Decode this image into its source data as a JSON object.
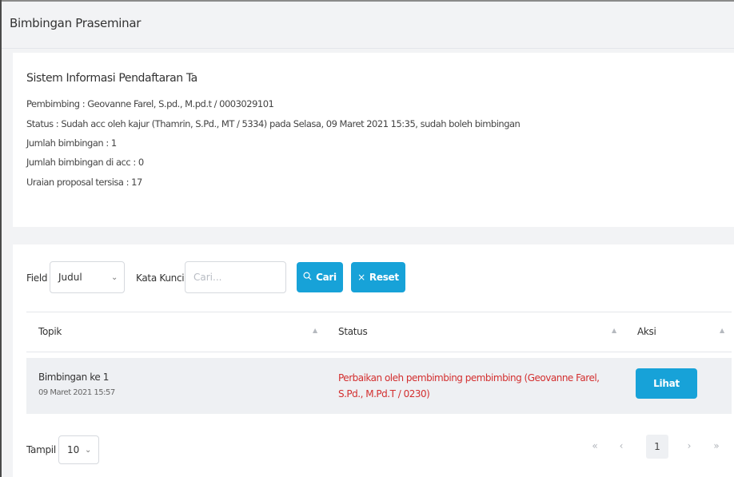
{
  "header": {
    "title": "Bimbingan Praseminar"
  },
  "info": {
    "title": "Sistem Informasi Pendaftaran Ta",
    "pembimbing": "Pembimbing : Geovanne Farel, S.pd., M.pd.t / 0003029101",
    "status": "Status : Sudah acc oleh kajur (Thamrin, S.Pd., MT / 5334) pada Selasa, 09 Maret 2021 15:35, sudah boleh bimbingan",
    "jumlah_bimbingan": "Jumlah bimbingan : 1",
    "jumlah_acc": "Jumlah bimbingan di acc : 0",
    "uraian": "Uraian proposal tersisa : 17"
  },
  "filter": {
    "field_label": "Field",
    "field_value": "Judul",
    "keyword_label": "Kata Kunci",
    "keyword_placeholder": "Cari...",
    "search_label": "Cari",
    "reset_label": "Reset"
  },
  "table": {
    "columns": [
      "Topik",
      "Status",
      "Aksi"
    ],
    "rows": [
      {
        "topic": "Bimbingan ke 1",
        "date": "09 Maret 2021 15:57",
        "status": "Perbaikan oleh pembimbing pembimbing (Geovanne Farel, S.Pd., M.Pd.T / 0230)",
        "action": "Lihat"
      }
    ]
  },
  "footer": {
    "tampil_label": "Tampil",
    "page_size": "10",
    "pagination": {
      "first": "«",
      "prev": "‹",
      "current": "1",
      "next": "›",
      "last": "»"
    }
  },
  "icons": {
    "dropdown": "chevron-down-icon",
    "search": "search-icon",
    "reset": "close-icon",
    "sort": "sort-icon"
  },
  "colors": {
    "primary": "#17a2d8",
    "status_red": "#d32f2f",
    "background": "#f2f3f5"
  }
}
